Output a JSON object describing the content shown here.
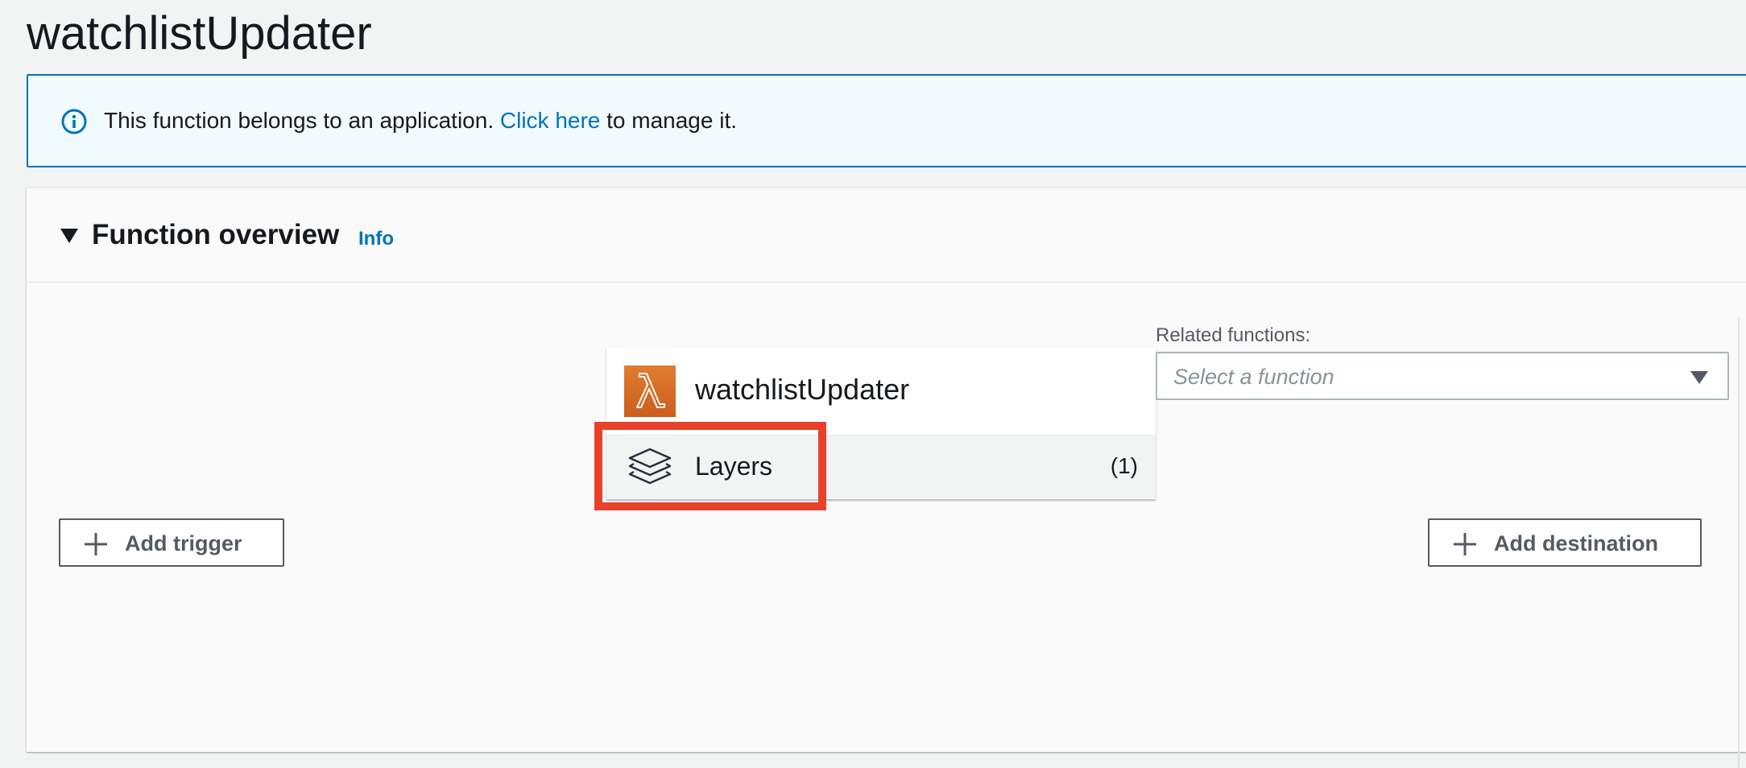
{
  "page": {
    "title": "watchlistUpdater"
  },
  "flash": {
    "icon": "info-circle-icon",
    "text_before": "This function belongs to an application. ",
    "link_text": "Click here",
    "text_after": " to manage it."
  },
  "overview": {
    "title": "Function overview",
    "info_link": "Info",
    "function_name": "watchlistUpdater",
    "function_icon": "lambda-icon",
    "layers_label": "Layers",
    "layers_count": "(1)",
    "related_functions_label": "Related functions:",
    "related_functions_placeholder": "Select a function",
    "add_trigger_label": "Add trigger",
    "add_destination_label": "Add destination"
  },
  "colors": {
    "accent_link": "#0073bb",
    "highlight": "#e8412b",
    "lambda_orange": "#e07d30"
  }
}
